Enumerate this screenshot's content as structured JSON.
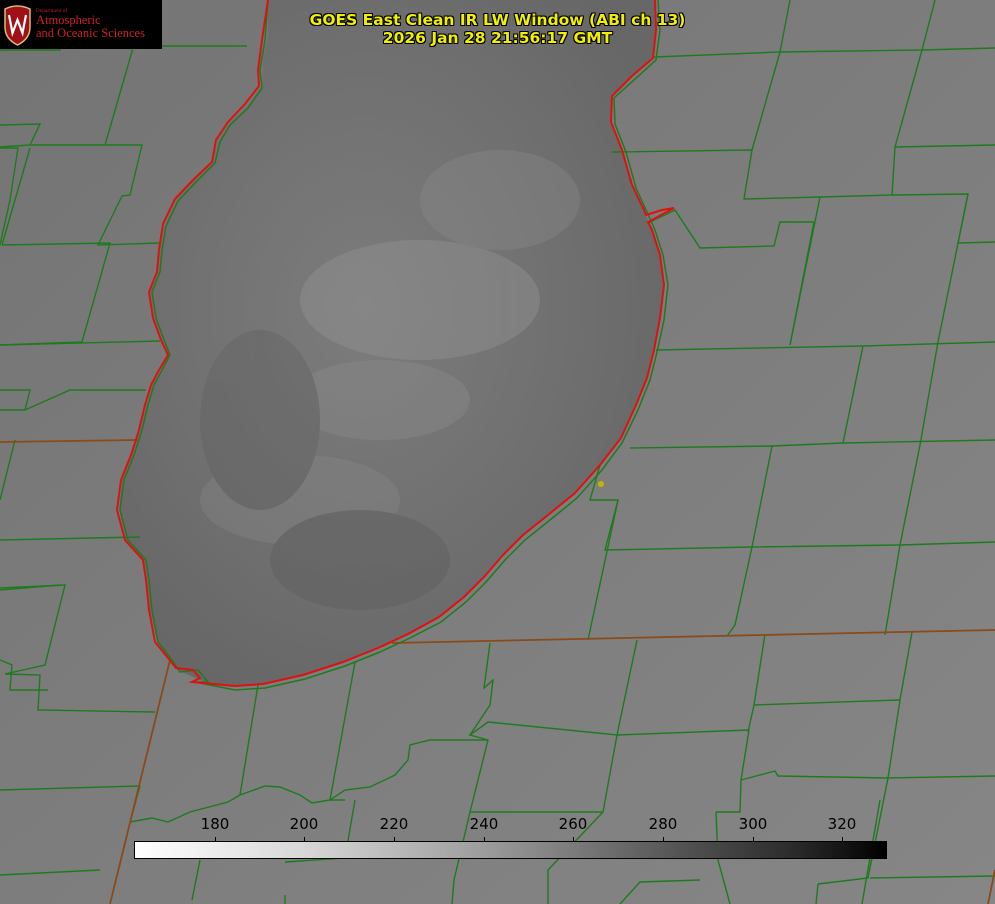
{
  "logo": {
    "dept": "Department of",
    "line1": "Atmospheric",
    "line2": "and Oceanic Sciences",
    "seal_letter": "W",
    "color": "#d0202b"
  },
  "title": {
    "line1": "GOES East Clean IR LW Window (ABI ch 13)",
    "line2": "2026 Jan 28 21:56:17 GMT",
    "color": "#f0f000"
  },
  "colorbar": {
    "min": 162,
    "max": 330,
    "ticks": [
      {
        "value": 180,
        "label": "180"
      },
      {
        "value": 200,
        "label": "200"
      },
      {
        "value": 220,
        "label": "220"
      },
      {
        "value": 240,
        "label": "240"
      },
      {
        "value": 260,
        "label": "260"
      },
      {
        "value": 280,
        "label": "280"
      },
      {
        "value": 300,
        "label": "300"
      },
      {
        "value": 320,
        "label": "320"
      }
    ]
  },
  "map": {
    "county_color": "#1f7a1f",
    "state_color": "#8a4a1a",
    "shoreline_color": "#e01010",
    "lake_color": "#6f6f6f",
    "land_color": "#7f7f7f"
  }
}
